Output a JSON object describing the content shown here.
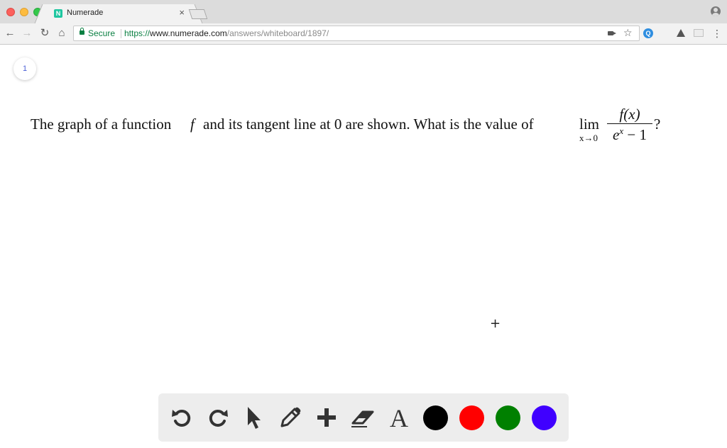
{
  "browser": {
    "tab_title": "Numerade",
    "tab_close": "×",
    "favicon_letter": "N",
    "secure_label": "Secure",
    "url_scheme": "https://",
    "url_host": "www.numerade.com",
    "url_path": "/answers/whiteboard/1897/",
    "menu_icon": "⋮",
    "ext_letter": "Q",
    "star": "☆",
    "back": "←",
    "forward": "→",
    "reload": "↻",
    "home": "⌂"
  },
  "page": {
    "page_number": "1",
    "question_part1": "The graph of a function ",
    "question_f": "f",
    "question_part2": " and its tangent line at 0 are shown. What is the value of",
    "lim": "lim",
    "lim_sub": "x→0",
    "numerator": "f(x)",
    "denominator_base": "e",
    "denominator_exp": "x",
    "denominator_rest": " − 1",
    "question_end": "?",
    "cursor": "+"
  },
  "toolbar": {
    "tools": [
      "undo-icon",
      "redo-icon",
      "pointer-icon",
      "pencil-icon",
      "add-icon",
      "eraser-icon",
      "text-icon"
    ],
    "text_tool_glyph": "A",
    "colors": {
      "black": "#000000",
      "red": "#ff0000",
      "green": "#008000",
      "blue": "#4000ff"
    }
  }
}
